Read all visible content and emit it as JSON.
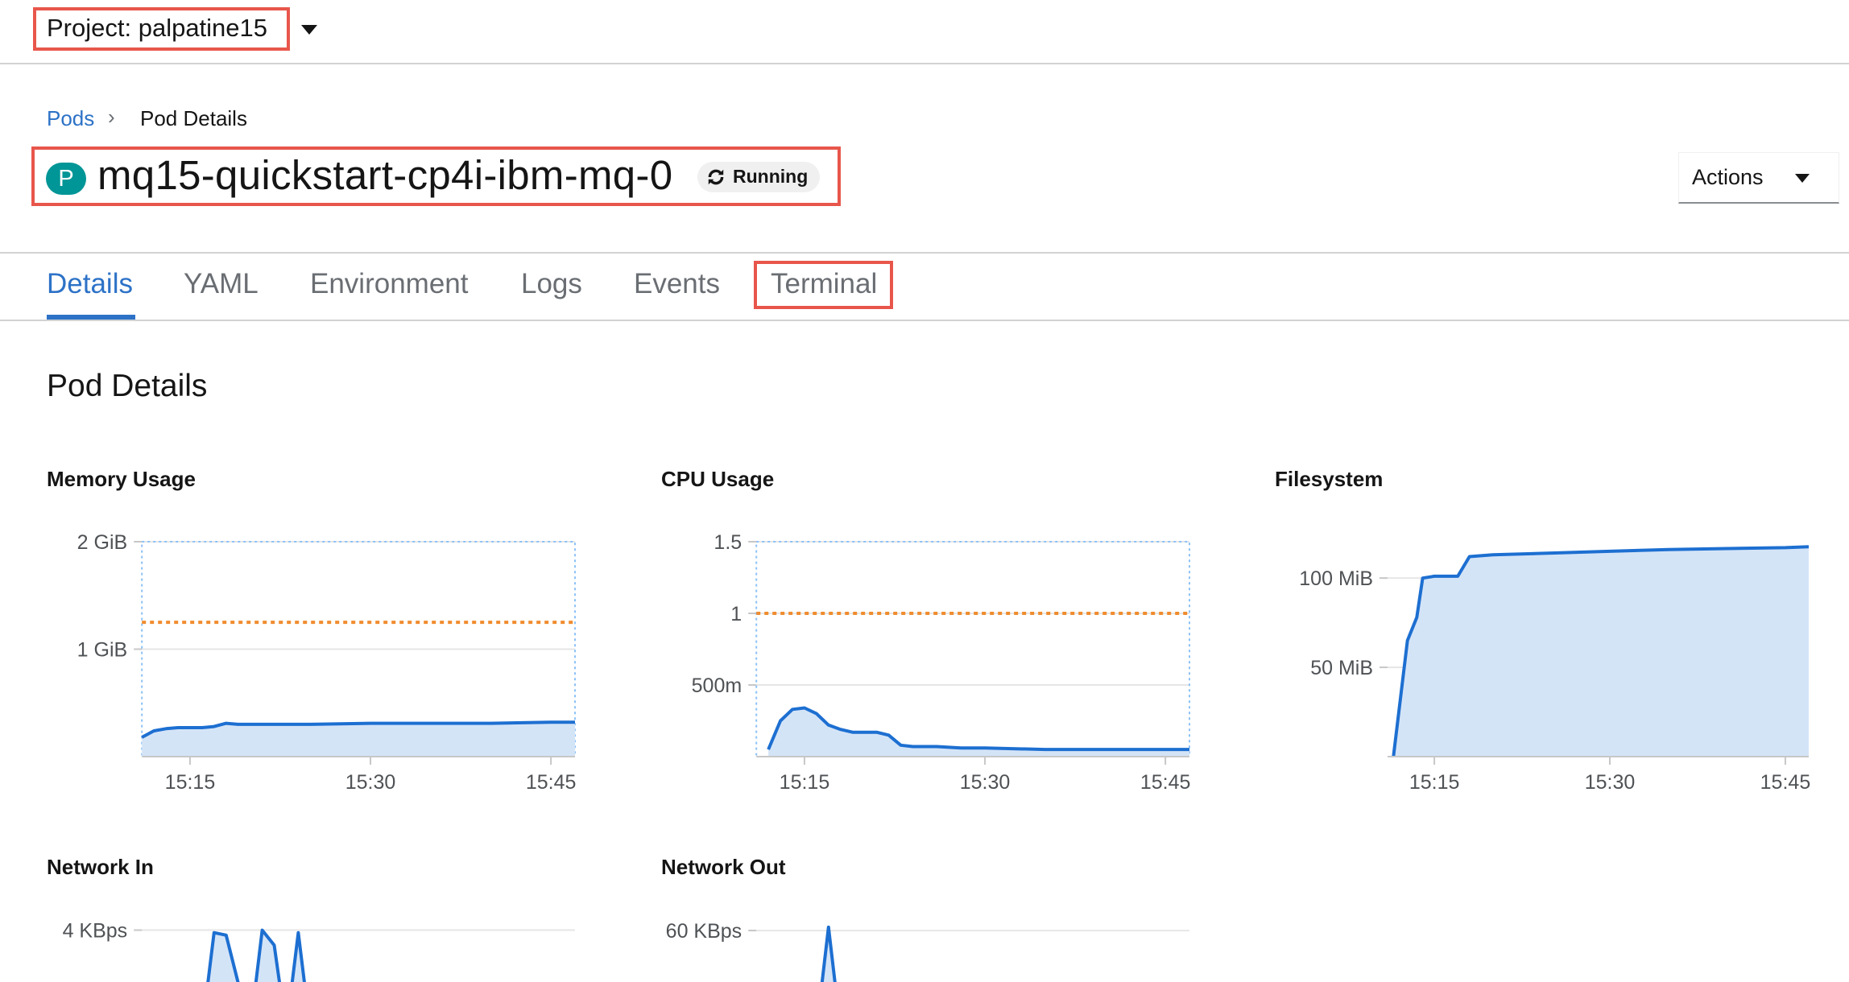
{
  "project": {
    "label": "Project: palpatine15"
  },
  "breadcrumb": {
    "pods": "Pods",
    "separator": "›",
    "current": "Pod Details"
  },
  "pod": {
    "badge": "P",
    "name": "mq15-quickstart-cp4i-ibm-mq-0",
    "status": "Running"
  },
  "actions": {
    "label": "Actions"
  },
  "tabs": [
    "Details",
    "YAML",
    "Environment",
    "Logs",
    "Events",
    "Terminal"
  ],
  "section": {
    "title": "Pod Details"
  },
  "colors": {
    "link": "#2d72c7",
    "line": "#1d6fd1",
    "fill": "#d4e4f7",
    "limit": "#f08c2e",
    "highlight": "#e8564b",
    "badge": "#009596"
  },
  "chart_data": [
    {
      "type": "area",
      "title": "Memory Usage",
      "y_ticks": [
        "2 GiB",
        "1 GiB"
      ],
      "x_ticks": [
        "15:15",
        "15:30",
        "15:45"
      ],
      "ylim": [
        0,
        2
      ],
      "y_unit": "GiB",
      "xlim": [
        11,
        47
      ],
      "limit": 1.25,
      "x": [
        11,
        12,
        13,
        14,
        15,
        16,
        17,
        18,
        19,
        21,
        25,
        30,
        35,
        40,
        45,
        47
      ],
      "values": [
        0.18,
        0.24,
        0.26,
        0.27,
        0.27,
        0.27,
        0.28,
        0.31,
        0.3,
        0.3,
        0.3,
        0.31,
        0.31,
        0.31,
        0.32,
        0.32
      ]
    },
    {
      "type": "area",
      "title": "CPU Usage",
      "y_ticks": [
        "1.5",
        "1",
        "500m"
      ],
      "x_ticks": [
        "15:15",
        "15:30",
        "15:45"
      ],
      "ylim": [
        0,
        1.5
      ],
      "y_unit": "cores",
      "xlim": [
        11,
        47
      ],
      "limit": 1.0,
      "x": [
        12,
        13,
        14,
        15,
        16,
        17,
        18,
        19,
        20,
        21,
        22,
        23,
        24,
        26,
        28,
        30,
        35,
        40,
        45,
        47
      ],
      "values": [
        0.05,
        0.25,
        0.33,
        0.34,
        0.3,
        0.22,
        0.19,
        0.17,
        0.17,
        0.17,
        0.15,
        0.08,
        0.07,
        0.07,
        0.06,
        0.06,
        0.05,
        0.05,
        0.05,
        0.05
      ]
    },
    {
      "type": "area",
      "title": "Filesystem",
      "y_ticks": [
        "100 MiB",
        "50 MiB"
      ],
      "x_ticks": [
        "15:15",
        "15:30",
        "15:45"
      ],
      "ylim": [
        0,
        119
      ],
      "y_unit": "MiB",
      "xlim": [
        11,
        47
      ],
      "x": [
        11.5,
        12.7,
        13.5,
        14,
        15,
        16,
        17,
        18,
        20,
        25,
        30,
        35,
        40,
        45,
        47
      ],
      "values": [
        0,
        65,
        78,
        100,
        101,
        101,
        101,
        112,
        113,
        114,
        115,
        116,
        116.5,
        117,
        117.5
      ]
    },
    {
      "type": "area",
      "title": "Network In",
      "y_ticks": [
        "4 KBps"
      ],
      "x_ticks": [],
      "y_unit": "KBps",
      "xlim": [
        11,
        47
      ],
      "x": [
        11,
        14,
        16,
        17,
        18,
        20,
        21,
        22,
        23,
        24,
        25,
        26,
        47
      ],
      "values": [
        0,
        0,
        0,
        3.9,
        3.8,
        0,
        4.0,
        3.4,
        0,
        3.9,
        0,
        0,
        0
      ]
    },
    {
      "type": "area",
      "title": "Network Out",
      "y_ticks": [
        "60 KBps"
      ],
      "x_ticks": [],
      "y_unit": "KBps",
      "xlim": [
        11,
        47
      ],
      "x": [
        11,
        15,
        16,
        17,
        18,
        47
      ],
      "values": [
        0,
        0,
        0,
        62,
        0,
        0
      ]
    }
  ]
}
